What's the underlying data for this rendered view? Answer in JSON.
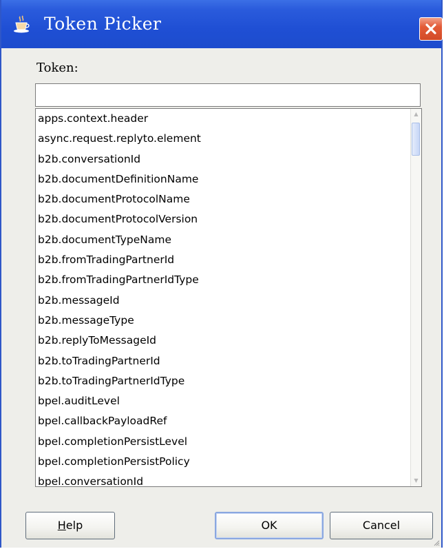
{
  "window": {
    "title": "Token Picker",
    "icon": "coffee-cup-icon",
    "close_icon": "close-icon",
    "close_color": "#d9532f",
    "titlebar_color": "#2a5bdc"
  },
  "form": {
    "token_label": "Token:",
    "token_value": ""
  },
  "tokens": [
    "apps.context.header",
    "async.request.replyto.element",
    "b2b.conversationId",
    "b2b.documentDefinitionName",
    "b2b.documentProtocolName",
    "b2b.documentProtocolVersion",
    "b2b.documentTypeName",
    "b2b.fromTradingPartnerId",
    "b2b.fromTradingPartnerIdType",
    "b2b.messageId",
    "b2b.messageType",
    "b2b.replyToMessageId",
    "b2b.toTradingPartnerId",
    "b2b.toTradingPartnerIdType",
    "bpel.auditLevel",
    "bpel.callbackPayloadRef",
    "bpel.completionPersistLevel",
    "bpel.completionPersistPolicy",
    "bpel.conversationId"
  ],
  "buttons": {
    "help_mnemonic": "H",
    "help_rest": "elp",
    "ok": "OK",
    "cancel": "Cancel"
  }
}
